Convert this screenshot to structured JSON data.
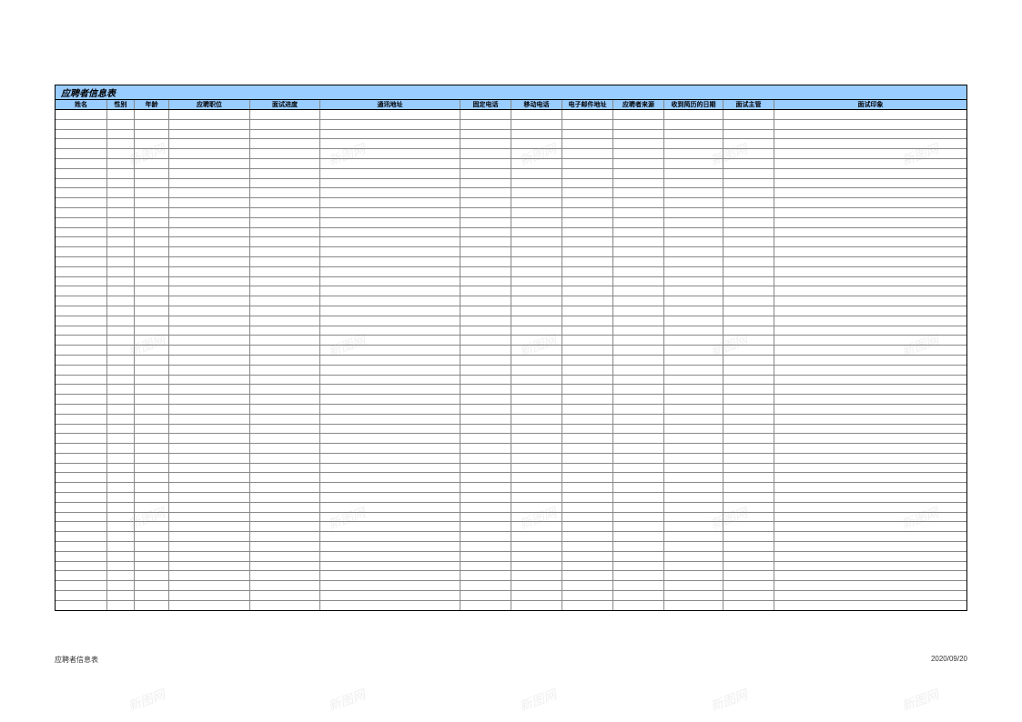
{
  "title": "应聘者信息表",
  "columns": [
    "姓名",
    "性别",
    "年龄",
    "应聘职位",
    "面试进度",
    "通讯地址",
    "固定电话",
    "移动电话",
    "电子邮件地址",
    "应聘者来源",
    "收到简历的日期",
    "面试主管",
    "面试印象"
  ],
  "empty_row_count": 51,
  "footer": {
    "left": "应聘者信息表",
    "right": "2020/09/20"
  },
  "watermark_text": "新图网"
}
